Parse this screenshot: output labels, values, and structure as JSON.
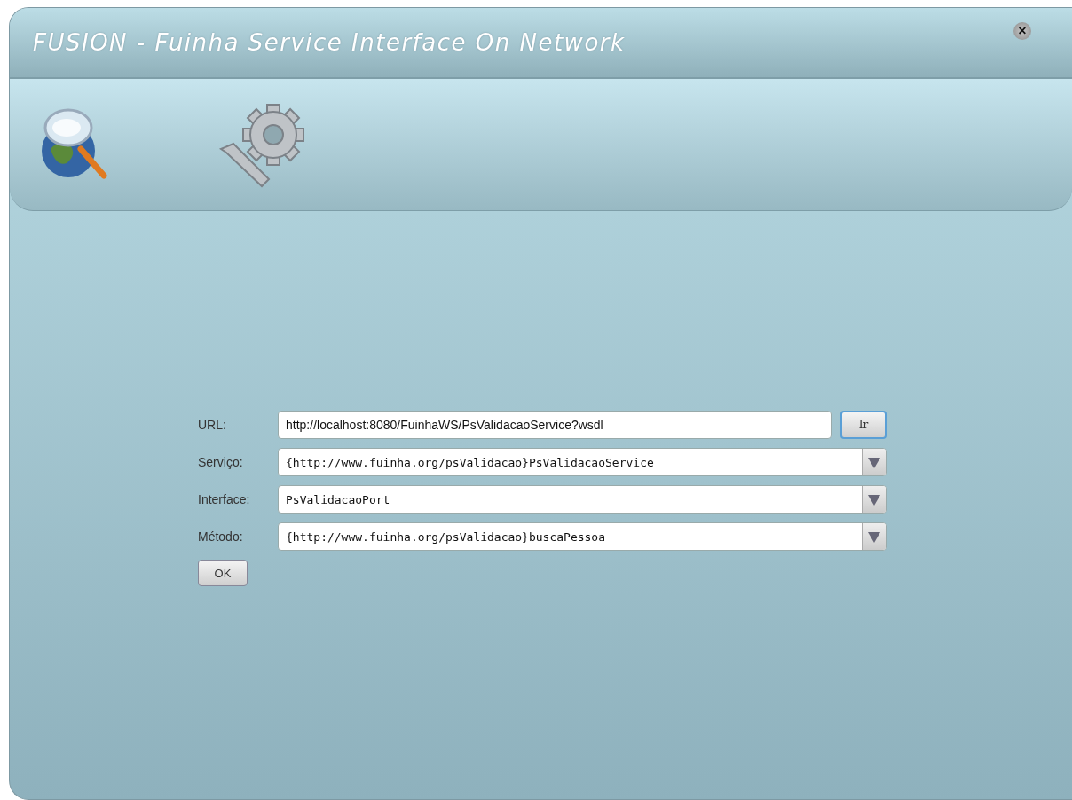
{
  "window": {
    "title": "FUSION - Fuinha Service Interface On Network",
    "close": "×"
  },
  "toolbar": {
    "tools": [
      {
        "kind": "globe-search"
      },
      {
        "kind": "settings"
      }
    ]
  },
  "form": {
    "fields": [
      {
        "label": "URL:",
        "kind": "text",
        "value": "http://localhost:8080/FuinhaWS/PsValidacaoService?wsdl",
        "button": "Ir"
      },
      {
        "label": "Serviço:",
        "kind": "combo",
        "value": "{http://www.fuinha.org/psValidacao}PsValidacaoService"
      },
      {
        "label": "Interface:",
        "kind": "combo",
        "value": "PsValidacaoPort"
      },
      {
        "label": "Método:",
        "kind": "combo",
        "value": "{http://www.fuinha.org/psValidacao}buscaPessoa"
      }
    ],
    "submit": "OK"
  }
}
